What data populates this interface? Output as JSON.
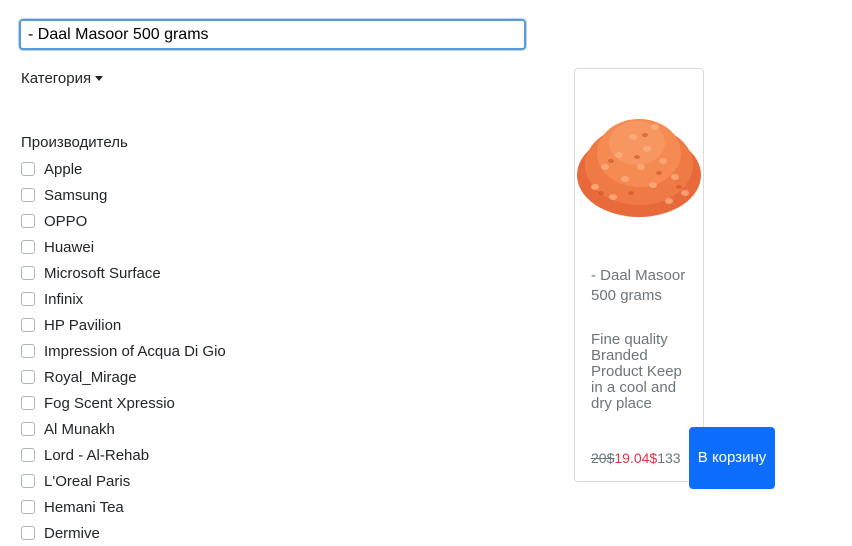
{
  "search": {
    "value": "- Daal Masoor 500 grams"
  },
  "filters": {
    "category_label": "Категория",
    "brand_heading": "Производитель",
    "brands": [
      "Apple",
      "Samsung",
      "OPPO",
      "Huawei",
      "Microsoft Surface",
      "Infinix",
      "HP Pavilion",
      "Impression of Acqua Di Gio",
      "Royal_Mirage",
      "Fog Scent Xpressio",
      "Al Munakh",
      "Lord - Al-Rehab",
      "L'Oreal Paris",
      "Hemani Tea",
      "Dermive"
    ]
  },
  "product": {
    "name": "- Daal Masoor 500 grams",
    "description": "Fine quality Branded Product Keep in a cool and dry place",
    "old_price": "20$",
    "new_price": "19.04$",
    "stock": "133",
    "image_icon": "red-lentils-image",
    "cart_button_label": "В корзину"
  },
  "colors": {
    "accent": "#0d6efd",
    "sale_price": "#dc3545",
    "muted_text": "#6c757d",
    "lentil": "#f07a45"
  }
}
